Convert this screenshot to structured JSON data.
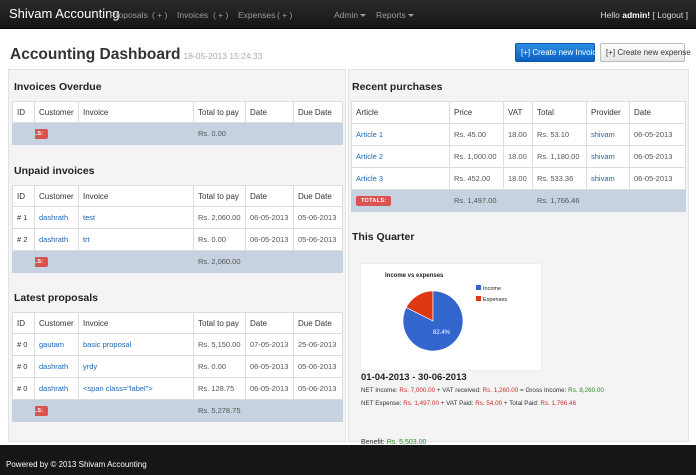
{
  "nav": {
    "brand": "Shivam Accounting",
    "proposals": "Proposals",
    "proposals_add": "( + )",
    "invoices": "Invoices",
    "invoices_add": "( + )",
    "expenses": "Expenses",
    "expenses_add": "( + )",
    "admin": "Admin",
    "reports": "Reports",
    "hello": "Hello",
    "username": "admin!",
    "logout": "Logout",
    "bracket_open": "[",
    "bracket_close": "]"
  },
  "header": {
    "title": "Accounting Dashboard",
    "datetime": "18-05-2013 15:24:33",
    "create_invoice": "[+] Create new Invoice",
    "create_expense": "[+] Create new expense"
  },
  "totals_label": "TOTALS:",
  "invoices_overdue": {
    "title": "Invoices Overdue",
    "columns": [
      "ID",
      "Customer",
      "Invoice",
      "Total to pay",
      "Date",
      "Due Date"
    ],
    "rows": [],
    "total": "Rs. 0.00"
  },
  "unpaid_invoices": {
    "title": "Unpaid invoices",
    "columns": [
      "ID",
      "Customer",
      "Invoice",
      "Total to pay",
      "Date",
      "Due Date"
    ],
    "rows": [
      [
        "# 1",
        "dashrath",
        "test",
        "Rs. 2,060.00",
        "06-05-2013",
        "05-06-2013"
      ],
      [
        "# 2",
        "dashrath",
        "trt",
        "Rs. 0.00",
        "06-05-2013",
        "05-06-2013"
      ]
    ],
    "total": "Rs. 2,060.00"
  },
  "latest_proposals": {
    "title": "Latest proposals",
    "columns": [
      "ID",
      "Customer",
      "Invoice",
      "Total to pay",
      "Date",
      "Due Date"
    ],
    "rows": [
      [
        "# 0",
        "gautam",
        "basic proposal",
        "Rs. 5,150.00",
        "07-05-2013",
        "25-06-2013"
      ],
      [
        "# 0",
        "dashrath",
        "yrdy",
        "Rs. 0.00",
        "06-05-2013",
        "05-06-2013"
      ],
      [
        "# 0",
        "dashrath",
        "<span class=\"label\">",
        "Rs. 128.75",
        "06-05-2013",
        "05-06-2013"
      ]
    ],
    "total": "Rs. 5,278.75"
  },
  "recent_purchases": {
    "title": "Recent purchases",
    "columns": [
      "Article",
      "Price",
      "VAT",
      "Total",
      "Provider",
      "Date"
    ],
    "rows": [
      [
        "Article 1",
        "Rs. 45.00",
        "18.00",
        "Rs. 53.10",
        "shivam",
        "06-05-2013"
      ],
      [
        "Article 2",
        "Rs. 1,000.00",
        "18.00",
        "Rs. 1,180.00",
        "shivam",
        "06-05-2013"
      ],
      [
        "Article 3",
        "Rs. 452.00",
        "18.00",
        "Rs. 533.36",
        "shivam",
        "06-05-2013"
      ]
    ],
    "total_price": "Rs. 1,497.00",
    "total_total": "Rs. 1,766.46"
  },
  "this_quarter": {
    "title": "This Quarter",
    "range": "01-04-2013 - 30-06-2013",
    "net_income_label": "NET Income:",
    "net_income": "Rs. 7,000.00",
    "vat_received_label": "+ VAT received:",
    "vat_received": "Rs. 1,260.00",
    "gross_income_label": "= Gross Income:",
    "gross_income": "Rs. 8,260.00",
    "net_expense_label": "NET Expense:",
    "net_expense": "Rs. 1,497.00",
    "vat_paid_label": "+ VAT Paid:",
    "vat_paid": "Rs. 54.00",
    "total_paid_label": "+ Total Paid:",
    "total_paid": "Rs. 1,766.46",
    "benefit_label": "Benefit:",
    "benefit": "Rs. 5,503.00"
  },
  "chart_data": {
    "type": "pie",
    "title": "Income vs expenses",
    "labels": [
      "Income",
      "Expenses"
    ],
    "values": [
      82.4,
      17.6
    ],
    "colors": [
      "#3366cc",
      "#dc3912"
    ],
    "slice_label": "82.4%",
    "legend": "right"
  },
  "footer": {
    "text": "Powered by © 2013 Shivam Accounting"
  }
}
